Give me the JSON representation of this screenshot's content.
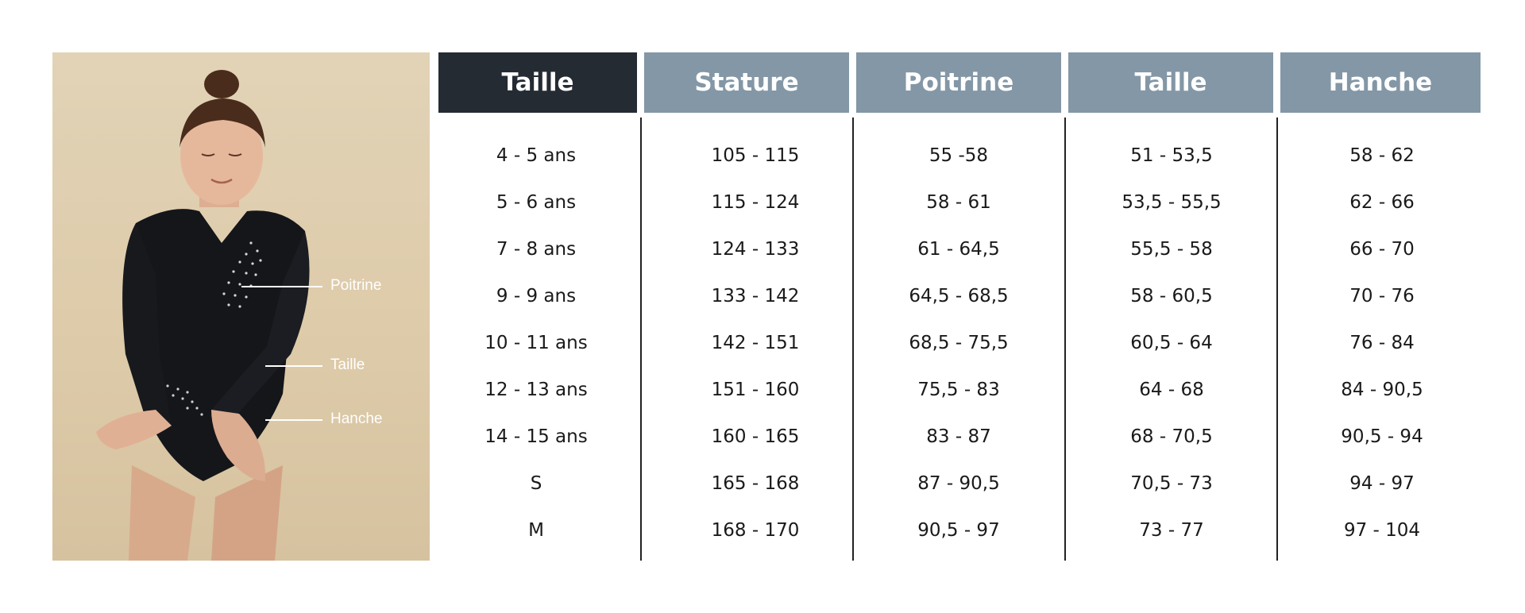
{
  "colors": {
    "header_dark": "#252b33",
    "header_light": "#8397a6",
    "photo_background": "#e0cfb0",
    "text": "#1a1a1a",
    "divider": "#222222"
  },
  "image": {
    "icon": "girl-in-black-leotard-photo",
    "labels": {
      "poitrine": "Poitrine",
      "taille": "Taille",
      "hanche": "Hanche"
    }
  },
  "table": {
    "headers": [
      "Taille",
      "Stature",
      "Poitrine",
      "Taille",
      "Hanche"
    ],
    "rows": [
      [
        "4 - 5 ans",
        "105 - 115",
        "55 -58",
        "51 - 53,5",
        "58 - 62"
      ],
      [
        "5 - 6 ans",
        "115 - 124",
        "58 - 61",
        "53,5 - 55,5",
        "62 - 66"
      ],
      [
        "7 - 8 ans",
        "124 - 133",
        "61 - 64,5",
        "55,5 - 58",
        "66 - 70"
      ],
      [
        "9 - 9 ans",
        "133 - 142",
        "64,5 - 68,5",
        "58 - 60,5",
        "70 - 76"
      ],
      [
        "10 - 11 ans",
        "142 - 151",
        "68,5 - 75,5",
        "60,5 - 64",
        "76 - 84"
      ],
      [
        "12 - 13 ans",
        "151 - 160",
        "75,5 - 83",
        "64 - 68",
        "84 - 90,5"
      ],
      [
        "14 - 15 ans",
        "160 - 165",
        "83 - 87",
        "68 - 70,5",
        "90,5 - 94"
      ],
      [
        "S",
        "165 - 168",
        "87 - 90,5",
        "70,5 - 73",
        "94 - 97"
      ],
      [
        "M",
        "168 - 170",
        "90,5 - 97",
        "73 - 77",
        "97 - 104"
      ]
    ]
  }
}
